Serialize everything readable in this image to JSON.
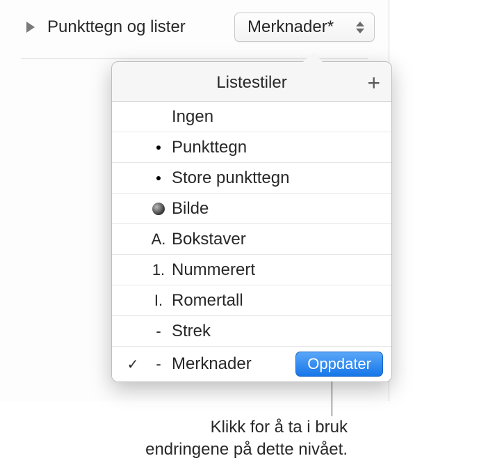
{
  "header": {
    "label": "Punkttegn og lister",
    "dropdown_value": "Merknader*"
  },
  "popover": {
    "title": "Listestiler",
    "items": [
      {
        "marker_type": "none",
        "marker": "",
        "label": "Ingen",
        "selected": false
      },
      {
        "marker_type": "bullet",
        "marker": "",
        "label": "Punkttegn",
        "selected": false
      },
      {
        "marker_type": "bullet",
        "marker": "",
        "label": "Store punkttegn",
        "selected": false
      },
      {
        "marker_type": "image",
        "marker": "",
        "label": "Bilde",
        "selected": false
      },
      {
        "marker_type": "text",
        "marker": "A.",
        "label": "Bokstaver",
        "selected": false
      },
      {
        "marker_type": "text",
        "marker": "1.",
        "label": "Nummerert",
        "selected": false
      },
      {
        "marker_type": "text",
        "marker": "I.",
        "label": "Romertall",
        "selected": false
      },
      {
        "marker_type": "text",
        "marker": "-",
        "label": "Strek",
        "selected": false
      },
      {
        "marker_type": "text",
        "marker": "-",
        "label": "Merknader",
        "selected": true,
        "update": true
      }
    ],
    "update_label": "Oppdater"
  },
  "callout": {
    "text": "Klikk for å ta i bruk endringene på dette nivået."
  }
}
